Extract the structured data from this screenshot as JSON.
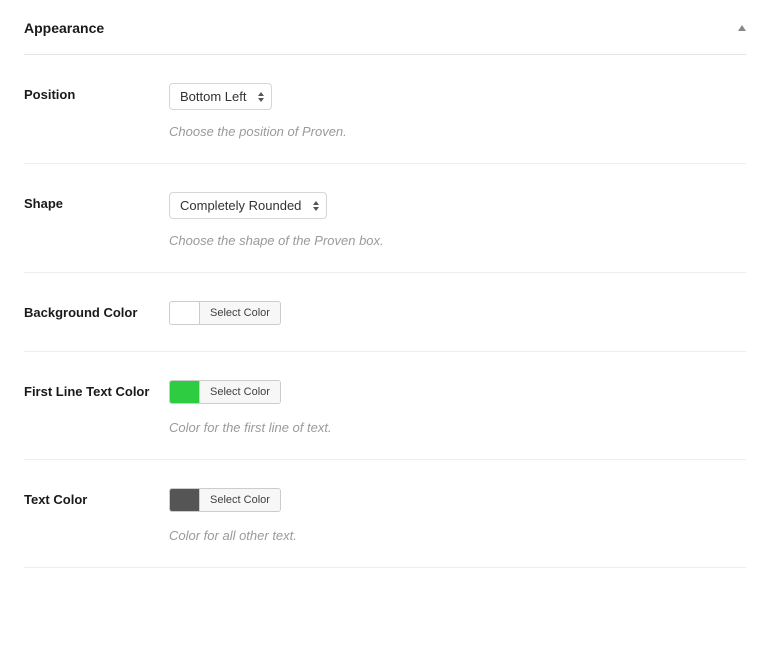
{
  "panel": {
    "title": "Appearance"
  },
  "rows": {
    "position": {
      "label": "Position",
      "value": "Bottom Left",
      "help": "Choose the position of Proven."
    },
    "shape": {
      "label": "Shape",
      "value": "Completely Rounded",
      "help": "Choose the shape of the Proven box."
    },
    "background_color": {
      "label": "Background Color",
      "swatch": "#ffffff",
      "button": "Select Color"
    },
    "first_line_text_color": {
      "label": "First Line Text Color",
      "swatch": "#2ecc40",
      "button": "Select Color",
      "help": "Color for the first line of text."
    },
    "text_color": {
      "label": "Text Color",
      "swatch": "#555555",
      "button": "Select Color",
      "help": "Color for all other text."
    }
  }
}
